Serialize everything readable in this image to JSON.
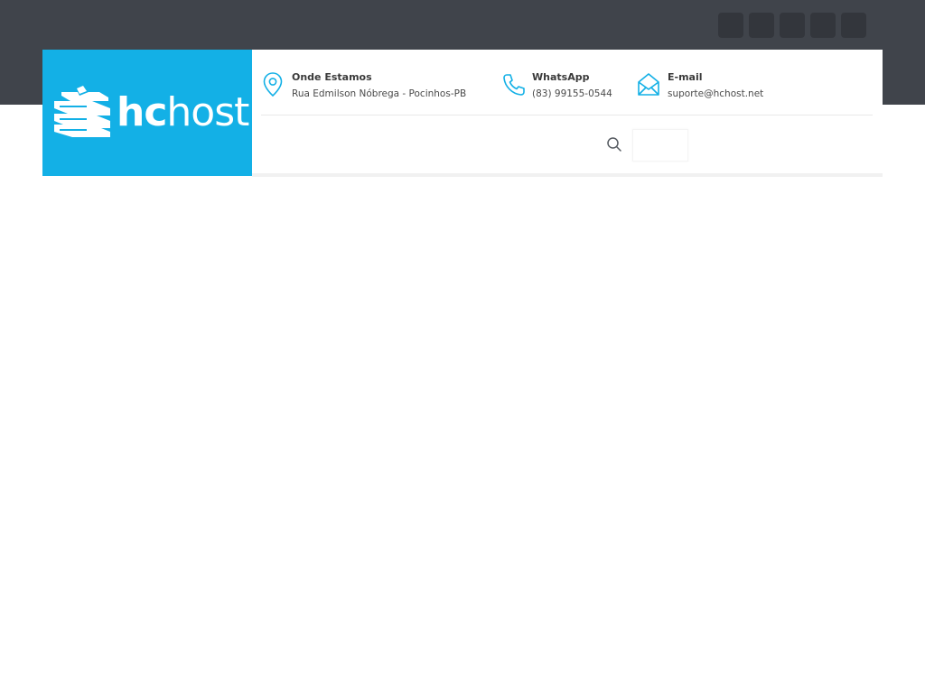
{
  "brand": {
    "logo_bold": "hc",
    "logo_light": "host",
    "accent_color": "#13b0e6",
    "topbar_color": "#40444b"
  },
  "social": {
    "icons": [
      "social-icon-1",
      "social-icon-2",
      "social-icon-3",
      "social-icon-4",
      "social-icon-5"
    ]
  },
  "contact": {
    "location": {
      "icon": "map-pin-icon",
      "title": "Onde Estamos",
      "value": "Rua Edmilson Nóbrega - Pocinhos-PB"
    },
    "whatsapp": {
      "icon": "phone-icon",
      "title": "WhatsApp",
      "value": "(83) 99155-0544"
    },
    "email": {
      "icon": "envelope-icon",
      "title": "E-mail",
      "value": "suporte@hchost.net"
    }
  },
  "nav": {
    "search_icon": "search-icon"
  }
}
